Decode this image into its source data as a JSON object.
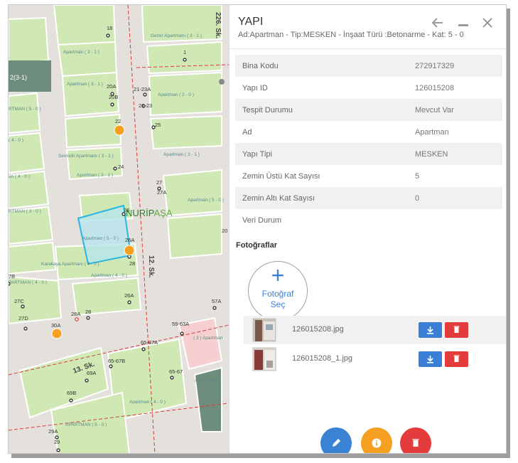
{
  "panel": {
    "title": "YAPI",
    "subtitle": "Ad:Apartman - Tip:MESKEN - İnşaat Türü :Betonarme - Kat: 5 - 0",
    "header_icons": [
      "back-arrow-icon",
      "minimize-icon",
      "close-icon"
    ]
  },
  "properties": [
    {
      "label": "Bina Kodu",
      "value": "272917329"
    },
    {
      "label": "Yapı ID",
      "value": "126015208"
    },
    {
      "label": "Tespit Durumu",
      "value": "Mevcut Var"
    },
    {
      "label": "Ad",
      "value": "Apartman"
    },
    {
      "label": "Yapı Tipi",
      "value": "MESKEN"
    },
    {
      "label": "Zemin Üstü Kat Sayısı",
      "value": "5"
    },
    {
      "label": "Zemin Altı Kat Sayısı",
      "value": "0"
    },
    {
      "label": "Veri Durum",
      "value": ""
    }
  ],
  "photos": {
    "section_title": "Fotoğraflar",
    "add_button": {
      "symbol": "+",
      "label": "Fotoğraf Seç"
    },
    "items": [
      {
        "filename": "126015208.jpg"
      },
      {
        "filename": "126015208_1.jpg"
      }
    ]
  },
  "actions": [
    "edit-icon",
    "info-icon",
    "delete-icon"
  ],
  "colors": {
    "primary": "#3a7fd5",
    "warning": "#f5a020",
    "danger": "#e43c3c",
    "selected_parcel": "#29b6e0"
  },
  "map": {
    "district": {
      "prefix": "NURİP",
      "suffix": "AŞA"
    },
    "streets": [
      "226. Sk.",
      "12. Sk.",
      "13. Sk."
    ],
    "buildings": [
      "Apartman ( 3 - 1 )",
      "Gezer Apartmanı ( 3 - 1 )",
      "Apartman ( 3 - 1 )",
      "2(3-1)",
      "Apartman ( 3 - 1 )",
      "Apartman ( 2 - 0 )",
      "RTMAN ( 5 - 0 )",
      "( 4 - 0 )",
      "Sevindir Apartmanı ( 3 - 1 )",
      "Apartman ( 3 - 1 )",
      "Apartman ( 3 - 1 )",
      "an ( 4 - 0 )",
      "Apartman ( 5 - 0 )",
      "RTMAN ( 3 - 0 )",
      "Apartman ( 5 - 0 )",
      "Karakaya Apartmanı ( 4 - 0 )",
      "Apartman ( 4 - 0 )",
      "PARTMAN ( 4 - 0 )",
      "( 3 ) Apartman",
      "APARTMAN",
      "Apartman ( 4 - 0 )",
      "APARTMAN ( 5 - 0 )"
    ],
    "door_numbers": [
      "18",
      "1",
      "20A",
      "20B",
      "21-23A",
      "21-23",
      "22",
      "25",
      "24",
      "27",
      "27A",
      "26",
      "20",
      "26A",
      "28",
      "26A",
      "57A",
      "27C",
      "27D",
      "28A",
      "28",
      "30A",
      "59-63A",
      "65-67A",
      "65-67B",
      "69A",
      "65-67",
      "69B",
      "29A",
      "29",
      "7B"
    ]
  }
}
